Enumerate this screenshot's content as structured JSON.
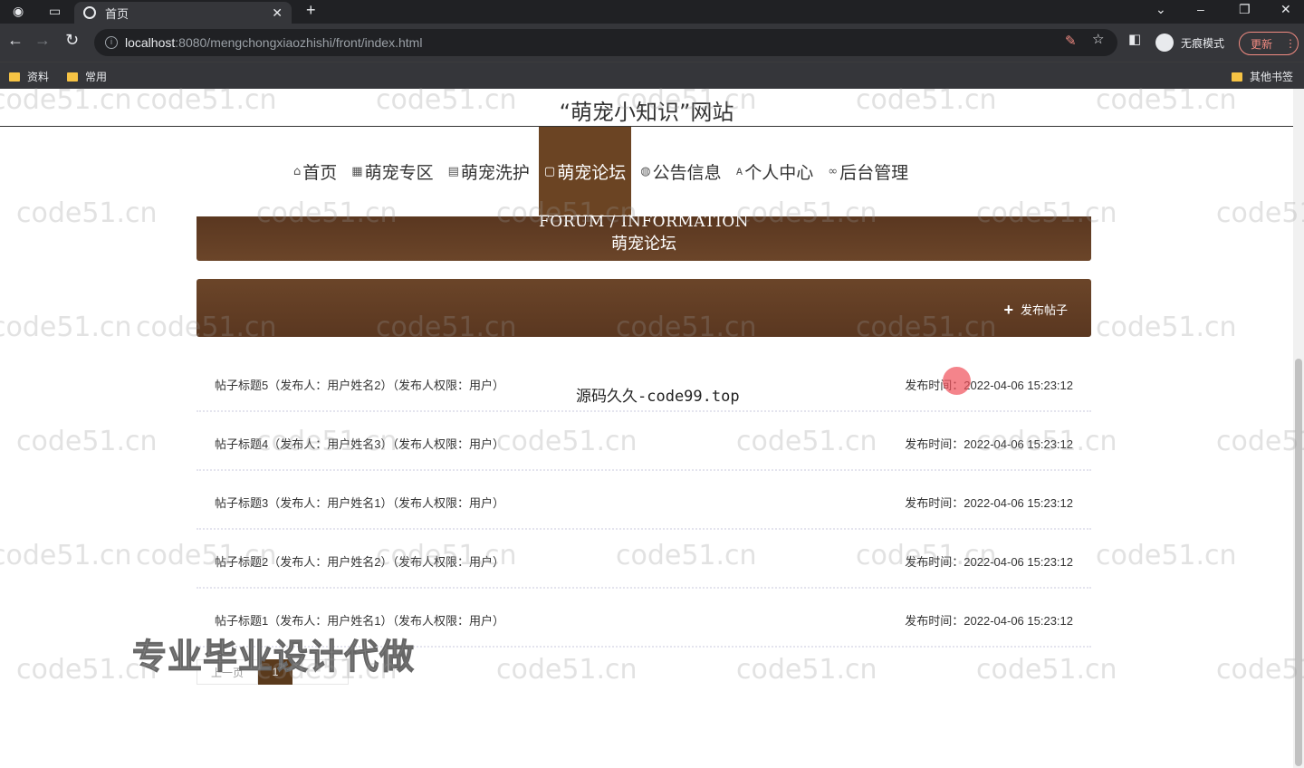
{
  "browser": {
    "tab_title": "首页",
    "url_host": "localhost",
    "url_rest": ":8080/mengchongxiaozhishi/front/index.html",
    "incognito_label": "无痕模式",
    "update_label": "更新",
    "bookmarks": [
      "资料",
      "常用"
    ],
    "other_bookmarks": "其他书签"
  },
  "site": {
    "title": "“萌宠小知识”网站"
  },
  "nav": [
    {
      "icon": "⌂",
      "label": "首页"
    },
    {
      "icon": "▦",
      "label": "萌宠专区"
    },
    {
      "icon": "▤",
      "label": "萌宠洗护"
    },
    {
      "icon": "▢",
      "label": "萌宠论坛",
      "active": true
    },
    {
      "icon": "◍",
      "label": "公告信息"
    },
    {
      "icon": "ᴀ",
      "label": "个人中心"
    },
    {
      "icon": "∞",
      "label": "后台管理"
    }
  ],
  "banner": {
    "en": "FORUM / INFORMATION",
    "cn": "萌宠论坛"
  },
  "actions": {
    "post_label": "发布帖子"
  },
  "posts": [
    {
      "title": "帖子标题5（发布人：用户姓名2）（发布人权限：用户）",
      "time_label": "发布时间：",
      "time": "2022-04-06 15:23:12"
    },
    {
      "title": "帖子标题4（发布人：用户姓名3）（发布人权限：用户）",
      "time_label": "发布时间：",
      "time": "2022-04-06 15:23:12"
    },
    {
      "title": "帖子标题3（发布人：用户姓名1）（发布人权限：用户）",
      "time_label": "发布时间：",
      "time": "2022-04-06 15:23:12"
    },
    {
      "title": "帖子标题2（发布人：用户姓名2）（发布人权限：用户）",
      "time_label": "发布时间：",
      "time": "2022-04-06 15:23:12"
    },
    {
      "title": "帖子标题1（发布人：用户姓名1）（发布人权限：用户）",
      "time_label": "发布时间：",
      "time": "2022-04-06 15:23:12"
    }
  ],
  "pager": {
    "prev": "上一页",
    "current": "1"
  },
  "overlays": {
    "watermark": "code51.cn",
    "source_text": "源码久久-code99.top",
    "ad_text": "专业毕业设计代做"
  },
  "colors": {
    "accent": "#6b4423",
    "banner": "#5a3720"
  }
}
